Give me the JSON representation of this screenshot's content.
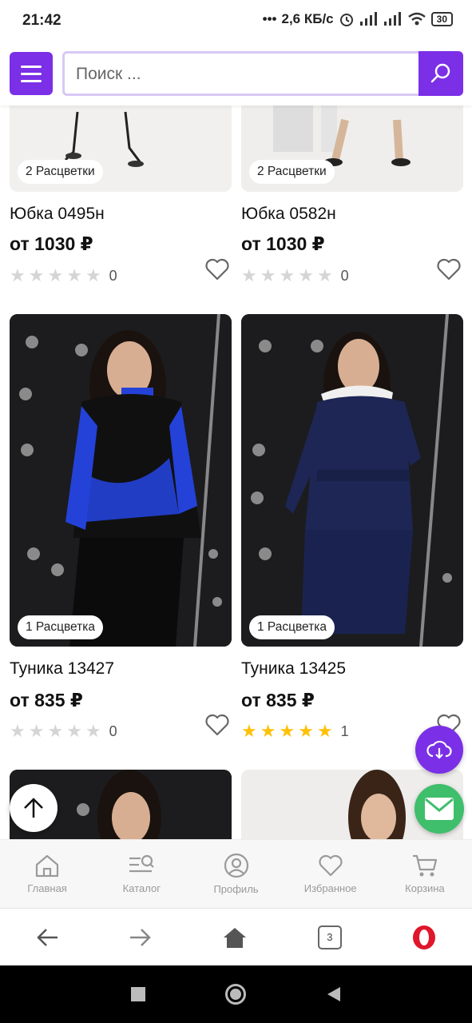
{
  "status_bar": {
    "time": "21:42",
    "network_speed": "2,6 КБ/с",
    "battery": "30"
  },
  "header": {
    "search_placeholder": "Поиск ...",
    "menu_icon": "hamburger-icon",
    "search_icon": "search-icon"
  },
  "products": [
    {
      "name": "Юбка 0495н",
      "price": "от 1030 ₽",
      "badge": "2 Расцветки",
      "rating": 0,
      "rating_count": "0"
    },
    {
      "name": "Юбка 0582н",
      "price": "от 1030 ₽",
      "badge": "2 Расцветки",
      "rating": 0,
      "rating_count": "0"
    },
    {
      "name": "Туника 13427",
      "price": "от 835 ₽",
      "badge": "1 Расцветка",
      "rating": 0,
      "rating_count": "0"
    },
    {
      "name": "Туника 13425",
      "price": "от 835 ₽",
      "badge": "1 Расцветка",
      "rating": 5,
      "rating_count": "1"
    }
  ],
  "bottom_nav": {
    "items": [
      {
        "label": "Главная",
        "icon": "home-icon"
      },
      {
        "label": "Каталог",
        "icon": "catalog-icon"
      },
      {
        "label": "Профиль",
        "icon": "profile-icon"
      },
      {
        "label": "Избранное",
        "icon": "heart-icon"
      },
      {
        "label": "Корзина",
        "icon": "cart-icon"
      }
    ]
  },
  "browser_bar": {
    "tab_count": "3"
  },
  "colors": {
    "accent": "#7b2fe6",
    "star": "#ffc107",
    "mail_fab": "#3fbe6b"
  }
}
